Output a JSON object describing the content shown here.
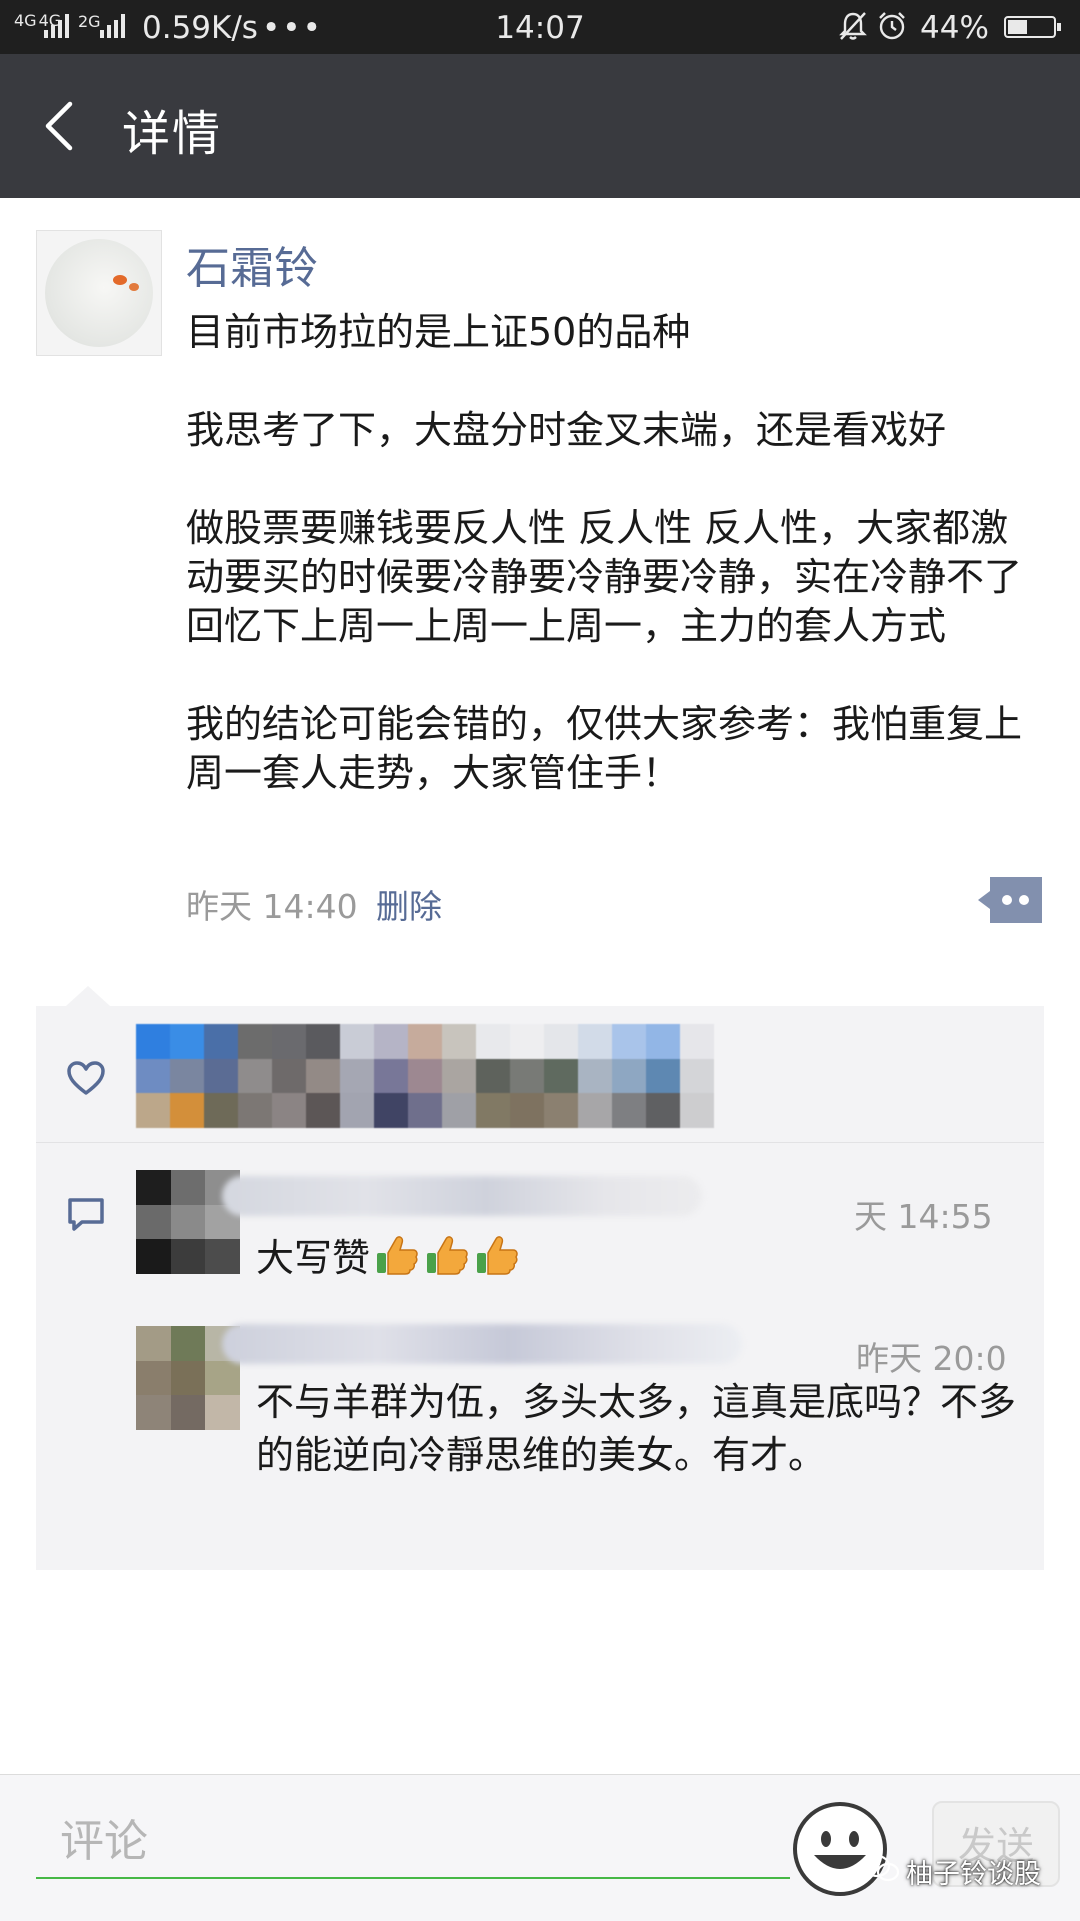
{
  "status_bar": {
    "network_a": "4G",
    "network_b": "4G",
    "network_c": "2G",
    "speed": "0.59K/s",
    "more": "•••",
    "time": "14:07",
    "battery_text": "44%",
    "battery_level": 0.44
  },
  "nav": {
    "title": "详情"
  },
  "post": {
    "author": "石霜铃",
    "paragraphs": [
      "目前市场拉的是上证50的品种",
      "我思考了下，大盘分时金叉末端，还是看戏好",
      "做股票要赚钱要反人性 反人性 反人性，大家都激动要买的时候要冷静要冷静要冷静，实在冷静不了回忆下上周一上周一上周一，主力的套人方式",
      "我的结论可能会错的，仅供大家参考：我怕重复上周一套人走势，大家管住手！"
    ],
    "time": "昨天 14:40",
    "delete_label": "删除"
  },
  "comments": [
    {
      "time": "天 14:55",
      "text": "大写赞",
      "thumbs": 3
    },
    {
      "time": "昨天 20:0",
      "text": "不与羊群为伍，多头太多，這真是底吗？不多的能逆向冷靜思维的美女。有才。",
      "thumbs": 0
    }
  ],
  "input": {
    "placeholder": "评论",
    "send_label": "发送"
  },
  "watermark": "柚子铃谈股",
  "colors": {
    "link": "#576b95",
    "nav_bg": "#393a3f",
    "input_underline": "#46b846"
  }
}
